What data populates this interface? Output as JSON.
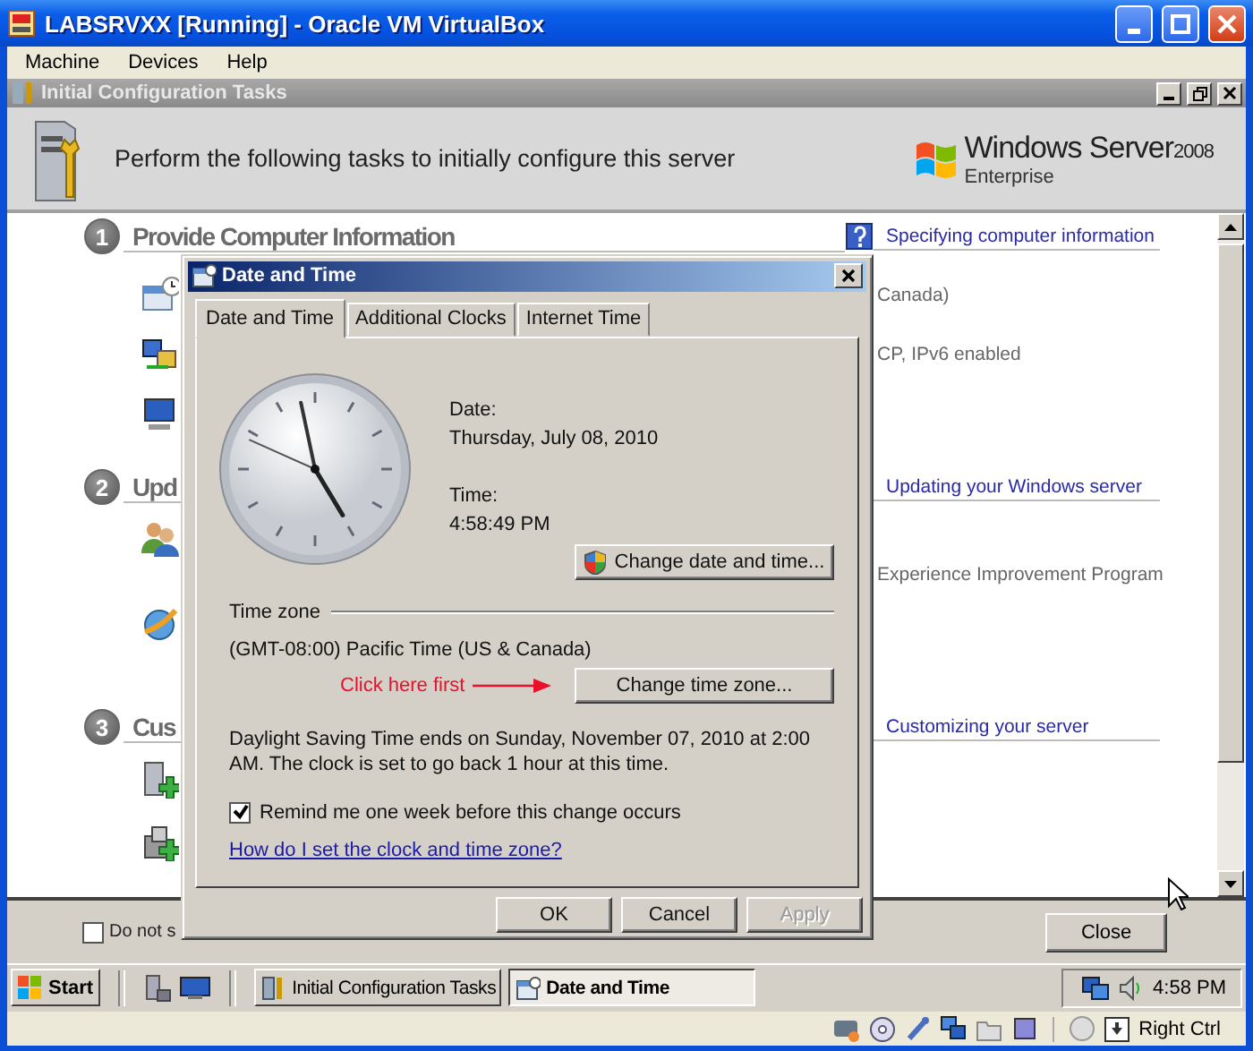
{
  "window": {
    "title": "LABSRVXX [Running] - Oracle VM VirtualBox"
  },
  "menu": [
    "Machine",
    "Devices",
    "Help"
  ],
  "app": {
    "title": "Initial Configuration Tasks",
    "header": "Perform the following tasks to initially configure this server",
    "logo": {
      "name": "Windows Server",
      "version": "2008",
      "edition": "Enterprise"
    }
  },
  "sections": [
    {
      "number": "1",
      "title": "Provide Computer Information",
      "help_link": "Specifying computer information",
      "rows": [
        {
          "detail": "Canada)"
        },
        {
          "detail": "CP, IPv6 enabled"
        },
        {}
      ]
    },
    {
      "number": "2",
      "title": "Upd",
      "help_link": "Updating your Windows server",
      "rows": [
        {
          "detail": "Experience Improvement Program"
        },
        {}
      ]
    },
    {
      "number": "3",
      "title": "Cus",
      "help_link": "Customizing your server",
      "rows": [
        {},
        {}
      ]
    }
  ],
  "footer": {
    "checkbox": {
      "label": "Do not s",
      "checked": false
    },
    "close_button": "Close"
  },
  "dialog": {
    "title": "Date and Time",
    "tabs": [
      {
        "label": "Date and Time",
        "selected": true
      },
      {
        "label": "Additional Clocks",
        "selected": false
      },
      {
        "label": "Internet Time",
        "selected": false
      }
    ],
    "date_label": "Date:",
    "date": "Thursday, July 08, 2010",
    "time_label": "Time:",
    "time": "4:58:49 PM",
    "change_datetime_button": "Change date and time...",
    "timezone_heading": "Time zone",
    "timezone": "(GMT-08:00) Pacific Time (US & Canada)",
    "annotation": "Click here first",
    "change_timezone_button": "Change time zone...",
    "dst_note": "Daylight Saving Time ends on Sunday, November 07, 2010 at 2:00 AM. The clock is set to go back 1 hour at this time.",
    "remind": {
      "label": "Remind me one week before this change occurs",
      "checked": true
    },
    "help_link": "How do I set the clock and time zone?",
    "buttons": [
      {
        "label": "OK",
        "disabled": false
      },
      {
        "label": "Cancel",
        "disabled": false
      },
      {
        "label": "Apply",
        "disabled": true
      }
    ]
  },
  "taskbar": {
    "start": "Start",
    "tasks": [
      {
        "label": "Initial Configuration Tasks",
        "selected": false
      },
      {
        "label": "Date and Time",
        "selected": true
      }
    ],
    "clock": "4:58 PM"
  },
  "statusbar": {
    "host_key": "Right Ctrl"
  }
}
